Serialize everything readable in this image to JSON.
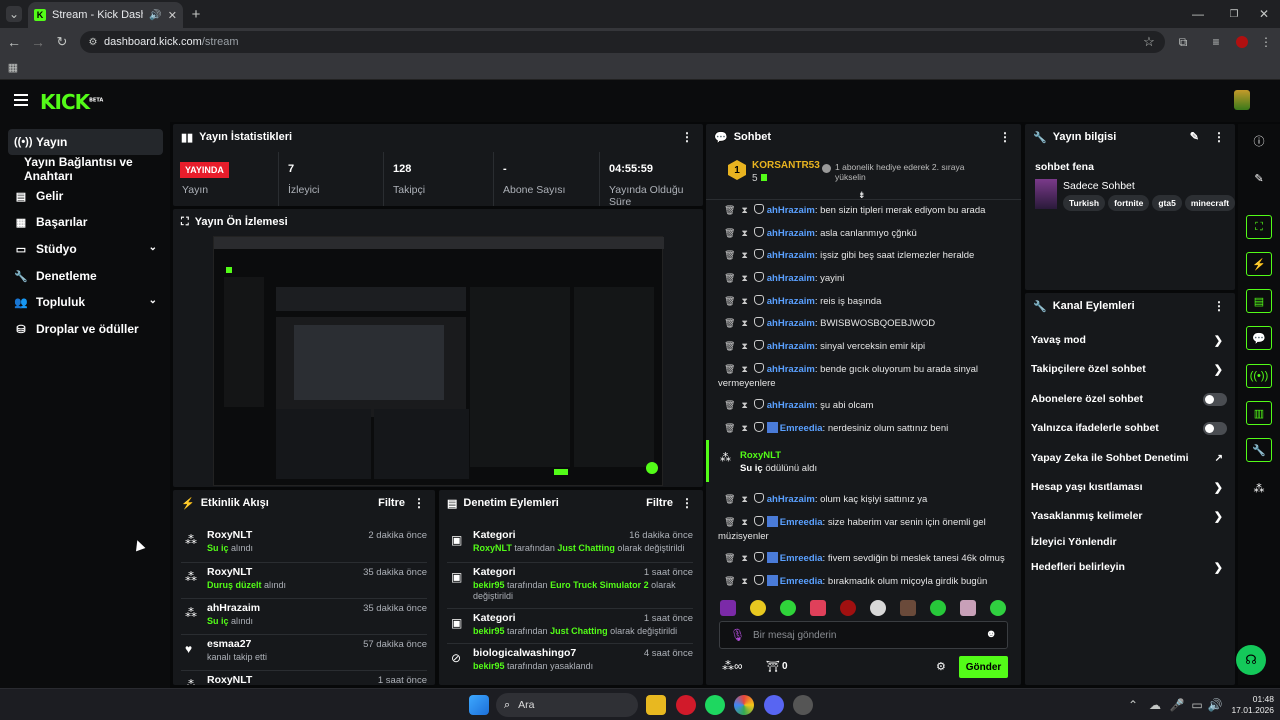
{
  "browser": {
    "tab_title": "Stream - Kick Dashboard",
    "url_host": "dashboard.kick.com",
    "url_path": "/stream"
  },
  "brand": {
    "logo": "KICK",
    "logo_sup": "BETA",
    "accent": "#53fc18"
  },
  "sidebar": {
    "items": [
      {
        "label": "Yayın",
        "icon": "broadcast-icon"
      },
      {
        "label": "Yayın Bağlantısı ve Anahtarı"
      },
      {
        "label": "Gelir",
        "icon": "revenue-icon"
      },
      {
        "label": "Başarılar",
        "icon": "achievements-icon"
      },
      {
        "label": "Stüdyo",
        "icon": "studio-icon"
      },
      {
        "label": "Denetleme",
        "icon": "moderation-icon"
      },
      {
        "label": "Topluluk",
        "icon": "community-icon"
      },
      {
        "label": "Droplar ve ödüller",
        "icon": "drops-icon"
      }
    ]
  },
  "stats": {
    "title": "Yayın İstatistikleri",
    "live_badge": "YAYINDA",
    "items": [
      {
        "value": "",
        "label": "Yayın"
      },
      {
        "value": "7",
        "label": "İzleyici"
      },
      {
        "value": "128",
        "label": "Takipçi"
      },
      {
        "value": "-",
        "label": "Abone Sayısı"
      },
      {
        "value": "04:55:59",
        "label": "Yayında Olduğu Süre"
      }
    ]
  },
  "preview": {
    "title": "Yayın Ön İzlemesi"
  },
  "activity": {
    "title": "Etkinlik Akışı",
    "filter": "Filtre",
    "rows": [
      {
        "name": "RoxyNLT",
        "time": "2 dakika önce",
        "hl": "Su iç",
        "rest": " alındı"
      },
      {
        "name": "RoxyNLT",
        "time": "35 dakika önce",
        "hl": "Duruş düzelt",
        "rest": " alındı"
      },
      {
        "name": "ahHrazaim",
        "time": "35 dakika önce",
        "hl": "Su iç",
        "rest": " alındı"
      },
      {
        "name": "esmaa27",
        "time": "57 dakika önce",
        "hl": "",
        "rest": "kanalı takip etti"
      },
      {
        "name": "RoxyNLT",
        "time": "1 saat önce",
        "hl": "",
        "rest": ""
      }
    ]
  },
  "modlog": {
    "title": "Denetim Eylemleri",
    "filter": "Filtre",
    "rows": [
      {
        "name": "Kategori",
        "time": "16 dakika önce",
        "user": "RoxyNLT",
        "mid": " tarafından ",
        "cat": "Just Chatting",
        "end": " olarak değiştirildi"
      },
      {
        "name": "Kategori",
        "time": "1 saat önce",
        "user": "bekir95",
        "mid": " tarafından ",
        "cat": "Euro Truck Simulator 2",
        "end": " olarak değiştirildi"
      },
      {
        "name": "Kategori",
        "time": "1 saat önce",
        "user": "bekir95",
        "mid": " tarafından ",
        "cat": "Just Chatting",
        "end": " olarak değiştirildi"
      },
      {
        "name": "biologicalwashingo7",
        "time": "4 saat önce",
        "user": "bekir95",
        "mid": " tarafından yasaklandı",
        "cat": "",
        "end": ""
      }
    ]
  },
  "chat": {
    "title": "Sohbet",
    "pinned_user": "KORSANTR53",
    "pinned_count": "5",
    "pinned_rank": "1",
    "pinned_text": "1 abonelik hediye ederek 2. sıraya yükselin",
    "messages": [
      {
        "user": "ahHrazaim",
        "text": ": ben sizin tipleri merak ediyom bu arada"
      },
      {
        "user": "ahHrazaim",
        "text": ": asla canlanmıyo çğnkü"
      },
      {
        "user": "ahHrazaim",
        "text": ": işsiz gibi beş saat izlemezler heralde"
      },
      {
        "user": "ahHrazaim",
        "text": ": yayini"
      },
      {
        "user": "ahHrazaim",
        "text": ": reis iş başında"
      },
      {
        "user": "ahHrazaim",
        "text": ": BWISBWOSBQOEBJWOD"
      },
      {
        "user": "ahHrazaim",
        "text": ": sinyal verceksin emir kipi"
      },
      {
        "user": "ahHrazaim",
        "text": ": bende gıcık oluyorum bu arada sinyal vermeyenlere"
      },
      {
        "user": "ahHrazaim",
        "text": ": şu abi olcam"
      },
      {
        "user": "Emreedia",
        "text": ": nerdesiniz olum sattınız beni"
      },
      {
        "user": "ahHrazaim",
        "text": ": olum kaç kişiyi sattınız ya"
      },
      {
        "user": "Emreedia",
        "text": ": size haberim var senin için önemli gel müzisyenler"
      },
      {
        "user": "Emreedia",
        "text": ": fivem sevdiğin bi meslek tanesi 46k olmuş"
      },
      {
        "user": "Emreedia",
        "text": ": bırakmadık olum miçoyla girdik bugün"
      }
    ],
    "redeem": {
      "user": "RoxyNLT",
      "hl": "Su iç",
      "rest": " ödülünü aldı"
    },
    "input_placeholder": "Bir mesaj gönderin",
    "points": "0",
    "send": "Gönder"
  },
  "streaminfo": {
    "title": "Yayın bilgisi",
    "stream_title": "sohbet fena",
    "category": "Sadece Sohbet",
    "tags": [
      "Turkish",
      "fortnite",
      "gta5",
      "minecraft"
    ]
  },
  "channel_actions": {
    "title": "Kanal Eylemleri",
    "items": [
      {
        "label": "Yavaş mod",
        "kind": "chevron"
      },
      {
        "label": "Takipçilere özel sohbet",
        "kind": "chevron"
      },
      {
        "label": "Abonelere özel sohbet",
        "kind": "toggle"
      },
      {
        "label": "Yalnızca ifadelerle sohbet",
        "kind": "toggle"
      },
      {
        "label": "Yapay Zeka ile Sohbet Denetimi",
        "kind": "link"
      },
      {
        "label": "Hesap yaşı kısıtlaması",
        "kind": "chevron"
      },
      {
        "label": "Yasaklanmış kelimeler",
        "kind": "chevron"
      },
      {
        "label": "İzleyici Yönlendir",
        "kind": "none"
      },
      {
        "label": "Hedefleri belirleyin",
        "kind": "chevron"
      }
    ]
  },
  "taskbar": {
    "search": "Ara",
    "time": "01:48",
    "date": "17.01.2026"
  }
}
